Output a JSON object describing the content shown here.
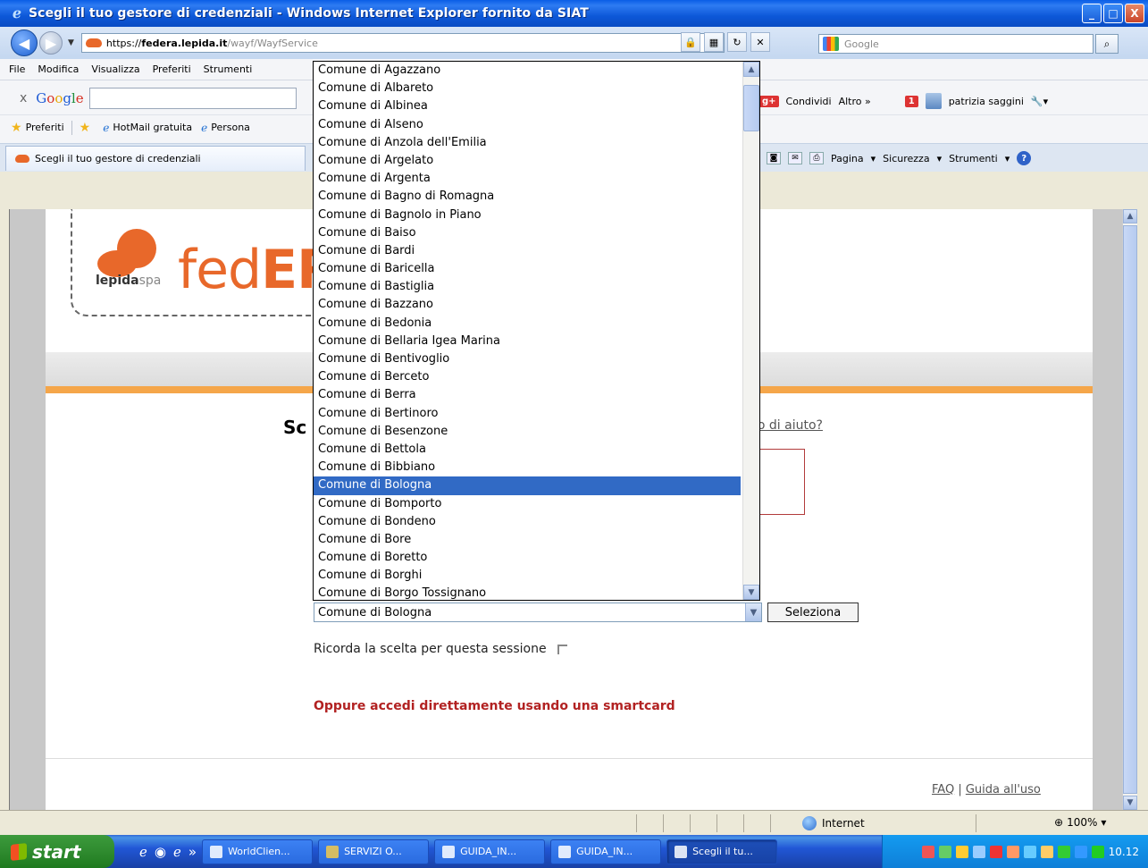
{
  "window": {
    "title": "Scegli il tuo gestore di credenziali - Windows Internet Explorer fornito da SIAT",
    "min": "_",
    "max": "□",
    "close": "X"
  },
  "address": {
    "protocol": "https://",
    "host": "federa.lepida.it",
    "path": "/wayf/WayfService",
    "search_placeholder": "Google"
  },
  "menu": [
    "File",
    "Modifica",
    "Visualizza",
    "Preferiti",
    "Strumenti"
  ],
  "google_toolbar": {
    "close": "x",
    "logo": [
      "G",
      "o",
      "o",
      "g",
      "l",
      "e"
    ],
    "share": "Condividi",
    "more": "Altro »",
    "notif": "1",
    "user": "patrizia saggini"
  },
  "favorites_bar": {
    "favorites": "Preferiti",
    "items": [
      "HotMail gratuita",
      "Persona"
    ]
  },
  "tab": {
    "title": "Scegli il tuo gestore di credenziali"
  },
  "command_bar": {
    "page": "Pagina",
    "security": "Sicurezza",
    "tools": "Strumenti"
  },
  "page": {
    "logo_lepida": "lepida",
    "logo_spa": "spa",
    "logo_fed": "fed",
    "logo_er": "ERa",
    "heading": "Sc",
    "help_link": "no di aiuto?",
    "selected_value": "Comune di Bologna",
    "select_button": "Seleziona",
    "remember_label": "Ricorda la scelta per questa sessione",
    "smartcard_label": "Oppure accedi direttamente usando una smartcard",
    "footer_faq": "FAQ",
    "footer_sep": "|",
    "footer_guide": "Guida all'uso"
  },
  "dropdown": {
    "options": [
      "Comune di Agazzano",
      "Comune di Albareto",
      "Comune di Albinea",
      "Comune di Alseno",
      "Comune di Anzola dell'Emilia",
      "Comune di Argelato",
      "Comune di Argenta",
      "Comune di Bagno di Romagna",
      "Comune di Bagnolo in Piano",
      "Comune di Baiso",
      "Comune di Bardi",
      "Comune di Baricella",
      "Comune di Bastiglia",
      "Comune di Bazzano",
      "Comune di Bedonia",
      "Comune di Bellaria Igea Marina",
      "Comune di Bentivoglio",
      "Comune di Berceto",
      "Comune di Berra",
      "Comune di Bertinoro",
      "Comune di Besenzone",
      "Comune di Bettola",
      "Comune di Bibbiano",
      "Comune di Bologna",
      "Comune di Bomporto",
      "Comune di Bondeno",
      "Comune di Bore",
      "Comune di Boretto",
      "Comune di Borghi",
      "Comune di Borgo Tossignano"
    ],
    "selected_index": 23
  },
  "status": {
    "zone": "Internet",
    "zoom": "100%"
  },
  "taskbar": {
    "start": "start",
    "buttons": [
      "WorldClien...",
      "SERVIZI O...",
      "GUIDA_IN...",
      "GUIDA_IN...",
      "Scegli il tu..."
    ],
    "active_index": 4,
    "clock": "10.12"
  }
}
